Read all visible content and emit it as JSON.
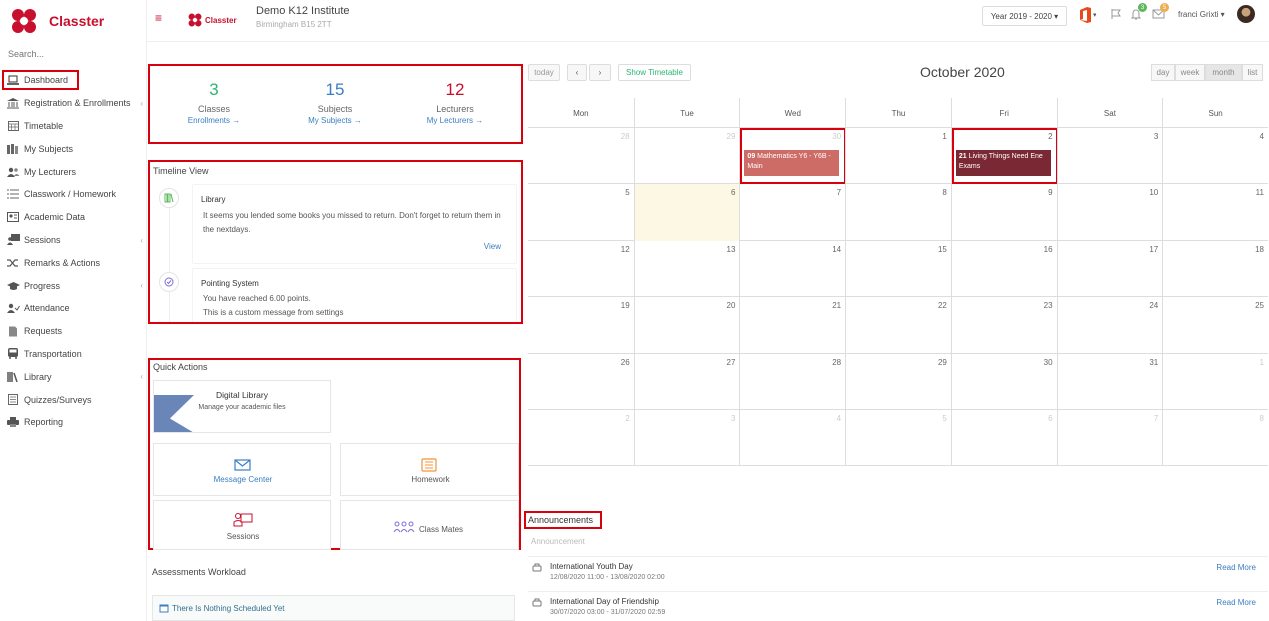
{
  "app": {
    "brand": "Classter",
    "search_placeholder": "Search..."
  },
  "sidebar": {
    "items": [
      {
        "label": "Dashboard",
        "icon": "laptop-icon"
      },
      {
        "label": "Registration & Enrollments",
        "icon": "institution-icon"
      },
      {
        "label": "Timetable",
        "icon": "calendar-grid-icon"
      },
      {
        "label": "My Subjects",
        "icon": "books-icon"
      },
      {
        "label": "My Lecturers",
        "icon": "users-icon"
      },
      {
        "label": "Classwork / Homework",
        "icon": "list-icon"
      },
      {
        "label": "Academic Data",
        "icon": "id-card-icon"
      },
      {
        "label": "Sessions",
        "icon": "presentation-icon"
      },
      {
        "label": "Remarks & Actions",
        "icon": "shuffle-icon"
      },
      {
        "label": "Progress",
        "icon": "graduation-cap-icon"
      },
      {
        "label": "Attendance",
        "icon": "user-check-icon"
      },
      {
        "label": "Requests",
        "icon": "document-icon"
      },
      {
        "label": "Transportation",
        "icon": "bus-icon"
      },
      {
        "label": "Library",
        "icon": "library-icon"
      },
      {
        "label": "Quizzes/Surveys",
        "icon": "checklist-icon"
      },
      {
        "label": "Reporting",
        "icon": "printer-icon"
      }
    ]
  },
  "header": {
    "school_name": "Demo K12 Institute",
    "school_address": "Birmingham B15 2TT",
    "school_logo_text": "Classter",
    "year": "Year 2019 - 2020",
    "notifications_count": "3",
    "messages_count": "5",
    "user_name": "franci Grixti"
  },
  "stats": [
    {
      "value": "3",
      "label": "Classes",
      "link": "Enrollments",
      "color": "#2bb673"
    },
    {
      "value": "15",
      "label": "Subjects",
      "link": "My Subjects",
      "color": "#3a7ec1"
    },
    {
      "value": "12",
      "label": "Lecturers",
      "link": "My Lecturers",
      "color": "#c8102e"
    }
  ],
  "timeline": {
    "title": "Timeline View",
    "items": [
      {
        "title": "Library",
        "body": "It seems you lended some books you missed to return. Don't forget to return them in the nextdays.",
        "action": "View"
      },
      {
        "title": "Pointing System",
        "line1": "You have reached 6.00 points.",
        "line2": "This is a custom message from settings"
      }
    ]
  },
  "quick_actions": {
    "title": "Quick Actions",
    "digital_library": {
      "title": "Digital Library",
      "subtitle": "Manage your academic files"
    },
    "message_center": "Message Center",
    "homework": "Homework",
    "sessions": "Sessions",
    "class_mates": "Class Mates"
  },
  "assessments": {
    "title": "Assessments Workload",
    "empty": "There Is Nothing Scheduled Yet"
  },
  "calendar": {
    "today": "today",
    "prev": "‹",
    "next": "›",
    "show_timetable": "Show Timetable",
    "title": "October 2020",
    "views": [
      "day",
      "week",
      "month",
      "list"
    ],
    "days": [
      "Mon",
      "Tue",
      "Wed",
      "Thu",
      "Fri",
      "Sat",
      "Sun"
    ],
    "weeks": [
      [
        "28",
        "29",
        "30",
        "1",
        "2",
        "3",
        "4"
      ],
      [
        "5",
        "6",
        "7",
        "8",
        "9",
        "10",
        "11"
      ],
      [
        "12",
        "13",
        "14",
        "15",
        "16",
        "17",
        "18"
      ],
      [
        "19",
        "20",
        "21",
        "22",
        "23",
        "24",
        "25"
      ],
      [
        "26",
        "27",
        "28",
        "29",
        "30",
        "31",
        "1"
      ],
      [
        "2",
        "3",
        "4",
        "5",
        "6",
        "7",
        "8"
      ]
    ],
    "events": [
      {
        "time": "09",
        "title": "Mathematics Y6 - Y6B - Main",
        "color": "#cd6b67"
      },
      {
        "time": "21",
        "title": "Living Things Need Ene Exams",
        "color": "#7a2833"
      }
    ]
  },
  "announcements": {
    "title": "Announcements",
    "subtitle": "Announcement",
    "items": [
      {
        "title": "International Youth Day",
        "date": "12/08/2020 11:00 - 13/08/2020 02:00",
        "action": "Read More"
      },
      {
        "title": "International Day of Friendship",
        "date": "30/07/2020 03:00 - 31/07/2020 02:59",
        "action": "Read More"
      }
    ]
  }
}
